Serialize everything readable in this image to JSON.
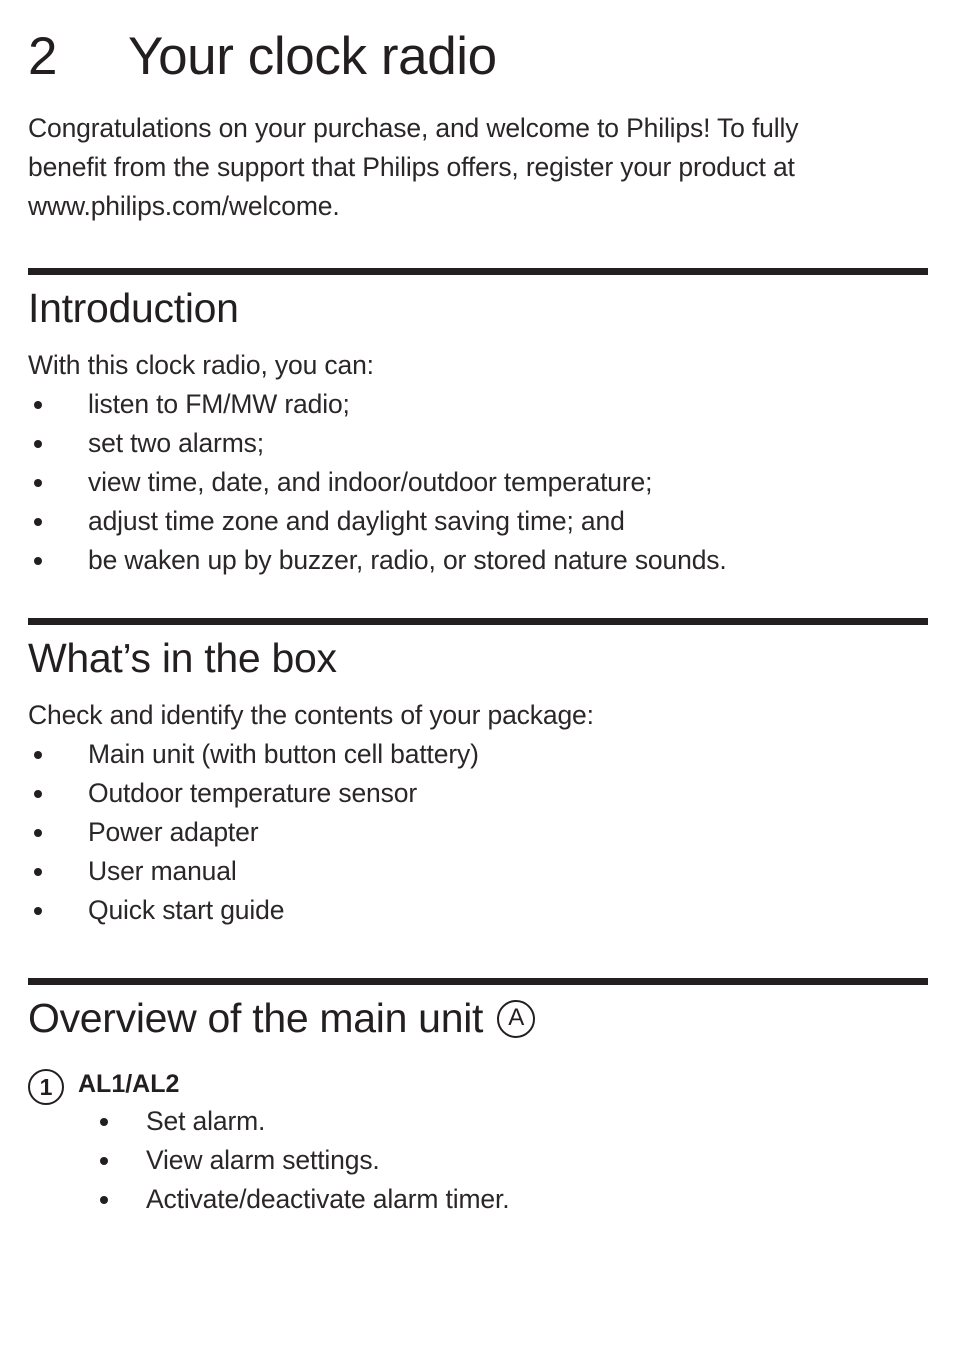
{
  "chapter": {
    "number": "2",
    "title": "Your clock radio"
  },
  "intro": {
    "paragraph": "Congratulations on your purchase, and welcome to Philips! To fully benefit from the support that Philips offers, register your product at www.philips.com/welcome."
  },
  "sections": [
    {
      "heading": "Introduction",
      "badge": "",
      "lead": "With this clock radio, you can:",
      "bullets": [
        "listen to FM/MW radio;",
        "set two alarms;",
        "view time, date, and indoor/outdoor temperature;",
        "adjust time zone and daylight saving time; and",
        "be waken up by buzzer, radio, or stored nature sounds."
      ]
    },
    {
      "heading": "What’s in the box",
      "badge": "",
      "lead": "Check and identify the contents of your package:",
      "bullets": [
        "Main unit (with button cell battery)",
        "Outdoor temperature sensor",
        "Power adapter",
        "User manual",
        "Quick start guide"
      ]
    },
    {
      "heading": "Overview of the main unit",
      "badge": "A",
      "lead": "",
      "bullets": []
    }
  ],
  "callouts": [
    {
      "number": "1",
      "label": "AL1/AL2",
      "bullets": [
        "Set alarm.",
        "View alarm settings.",
        "Activate/deactivate alarm timer."
      ]
    }
  ],
  "colors": {
    "text": "#231f20",
    "body_text": "#2b2728",
    "rule": "#231f20",
    "background": "#ffffff"
  }
}
